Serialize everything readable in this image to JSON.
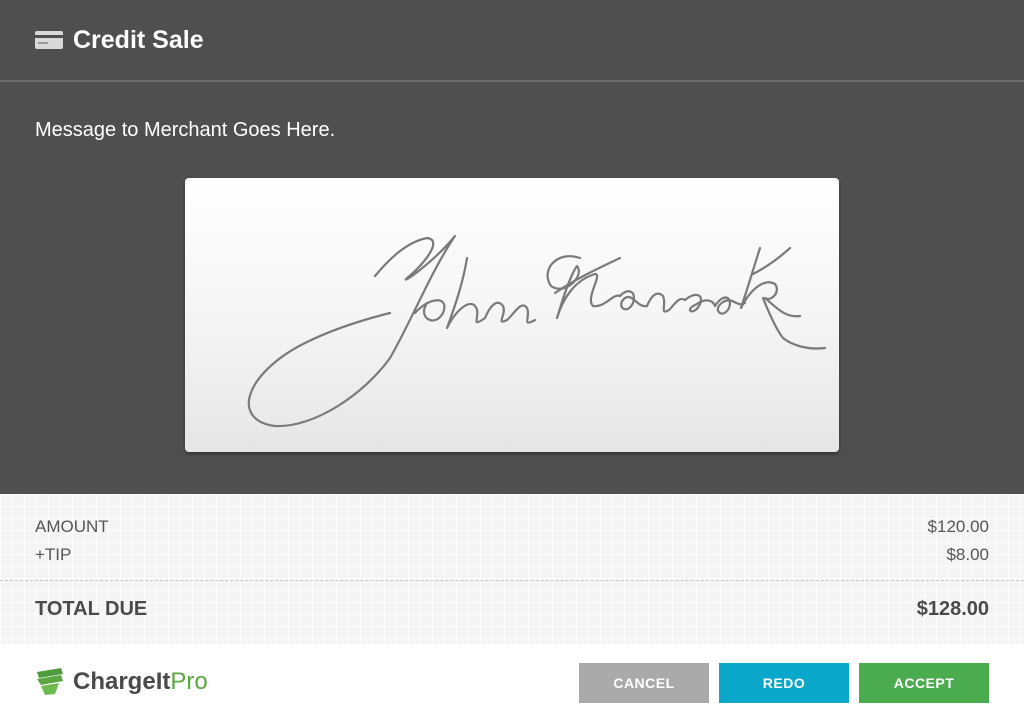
{
  "header": {
    "icon": "credit-card-icon",
    "title": "Credit Sale"
  },
  "main": {
    "message": "Message to Merchant Goes Here.",
    "signature_pad": {
      "signature": "John Hancock"
    }
  },
  "totals": {
    "amount_label": "AMOUNT",
    "amount_value": "$120.00",
    "tip_label": "+TIP",
    "tip_value": "$8.00",
    "total_label": "TOTAL DUE",
    "total_value": "$128.00"
  },
  "footer": {
    "logo_main": "ChargeIt",
    "logo_accent": "Pro",
    "buttons": {
      "cancel": "CANCEL",
      "redo": "REDO",
      "accept": "ACCEPT"
    }
  },
  "colors": {
    "header_bg": "#4f4f4f",
    "cancel": "#aaaaaa",
    "redo": "#09a7c9",
    "accept": "#4bab4f",
    "brand_green": "#5aa742"
  }
}
